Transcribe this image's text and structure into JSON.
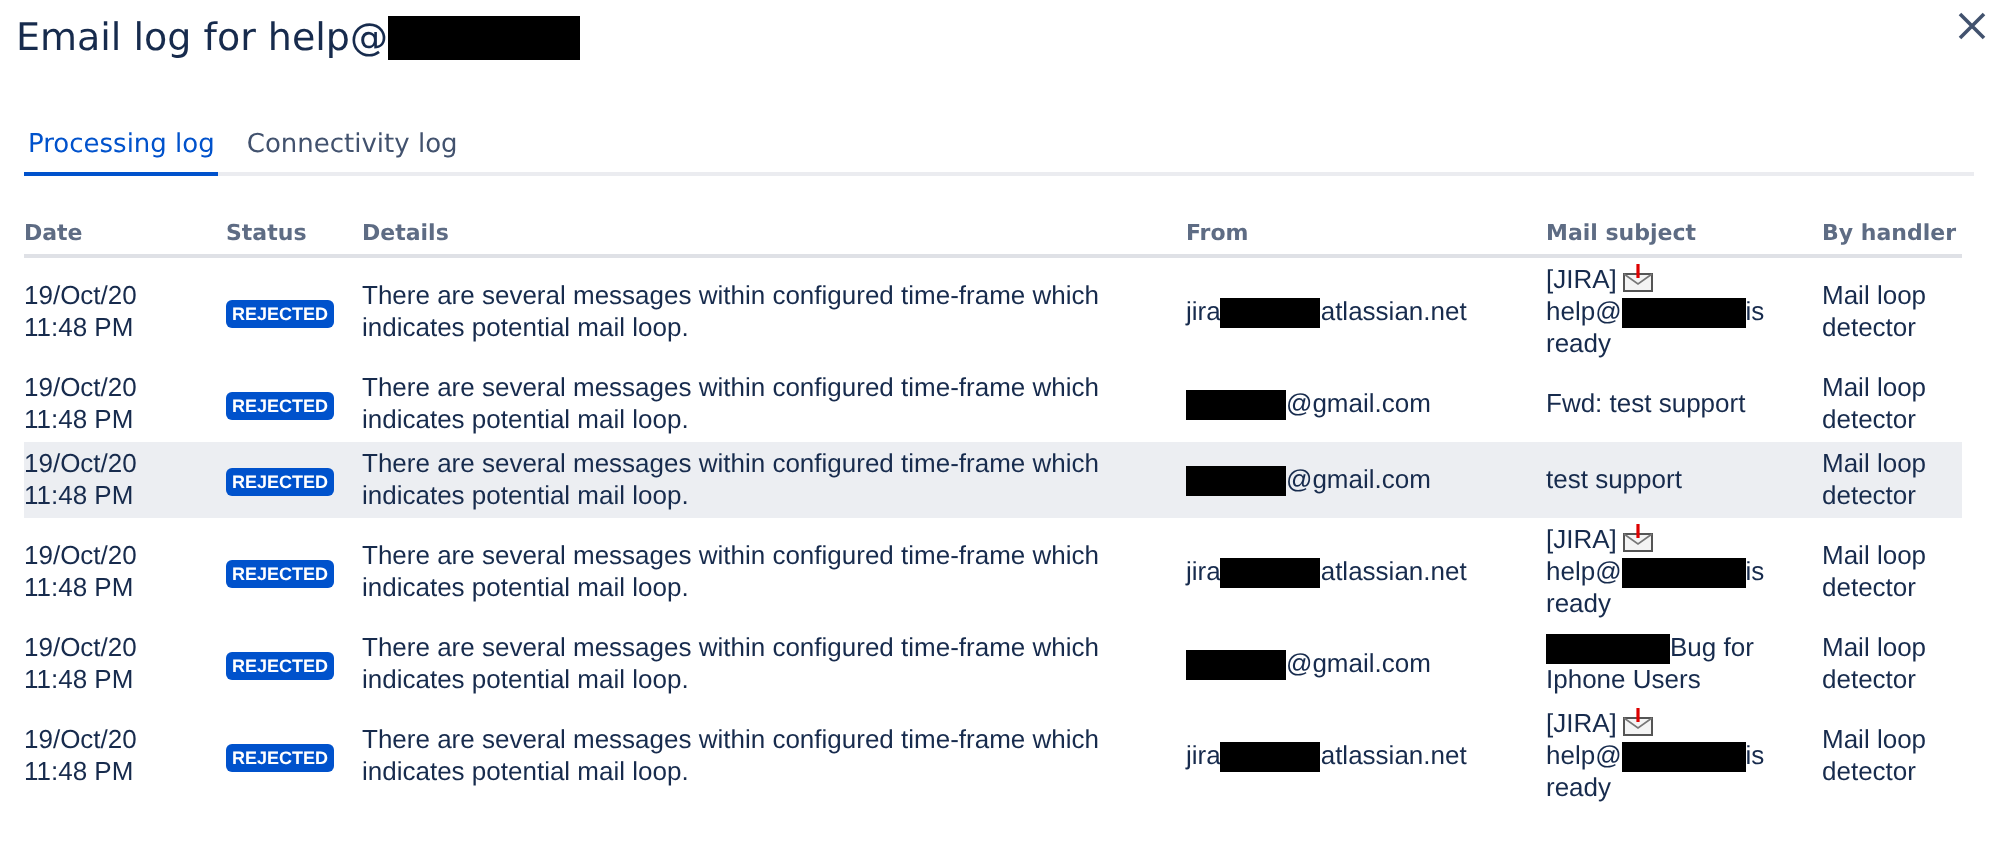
{
  "title": [
    {
      "kind": "text",
      "text": "Email log for help@"
    },
    {
      "kind": "redaction"
    }
  ],
  "tabs": [
    {
      "label": "Processing log",
      "selected": true
    },
    {
      "label": "Connectivity log",
      "selected": false
    }
  ],
  "table": {
    "columns": [
      "Date",
      "Status",
      "Details",
      "From",
      "Mail subject",
      "By handler"
    ],
    "rows": [
      {
        "highlighted": false,
        "date": "19/Oct/20 11:48 PM",
        "status": "REJECTED",
        "details": "There are several messages within configured time-frame which indicates potential mail loop.",
        "from": [
          {
            "kind": "text",
            "text": "jira"
          },
          {
            "kind": "redaction"
          },
          {
            "kind": "text",
            "text": "atlassian.net"
          }
        ],
        "subject": [
          [
            {
              "kind": "text",
              "text": "[JIRA]"
            },
            {
              "kind": "envelope"
            }
          ],
          [
            {
              "kind": "text",
              "text": "help@"
            },
            {
              "kind": "redaction"
            },
            {
              "kind": "text",
              "text": "is"
            }
          ],
          [
            {
              "kind": "text",
              "text": "ready"
            }
          ]
        ],
        "handler": "Mail loop detector"
      },
      {
        "highlighted": false,
        "date": "19/Oct/20 11:48 PM",
        "status": "REJECTED",
        "details": "There are several messages within configured time-frame which indicates potential mail loop.",
        "from": [
          {
            "kind": "redaction"
          },
          {
            "kind": "text",
            "text": "@gmail.com"
          }
        ],
        "subject": [
          [
            {
              "kind": "text",
              "text": "Fwd: test support"
            }
          ]
        ],
        "handler": "Mail loop detector"
      },
      {
        "highlighted": true,
        "date": "19/Oct/20 11:48 PM",
        "status": "REJECTED",
        "details": "There are several messages within configured time-frame which indicates potential mail loop.",
        "from": [
          {
            "kind": "redaction"
          },
          {
            "kind": "text",
            "text": "@gmail.com"
          }
        ],
        "subject": [
          [
            {
              "kind": "text",
              "text": "test support"
            }
          ]
        ],
        "handler": "Mail loop detector"
      },
      {
        "highlighted": false,
        "date": "19/Oct/20 11:48 PM",
        "status": "REJECTED",
        "details": "There are several messages within configured time-frame which indicates potential mail loop.",
        "from": [
          {
            "kind": "text",
            "text": "jira"
          },
          {
            "kind": "redaction"
          },
          {
            "kind": "text",
            "text": "atlassian.net"
          }
        ],
        "subject": [
          [
            {
              "kind": "text",
              "text": "[JIRA]"
            },
            {
              "kind": "envelope"
            }
          ],
          [
            {
              "kind": "text",
              "text": "help@"
            },
            {
              "kind": "redaction"
            },
            {
              "kind": "text",
              "text": "is"
            }
          ],
          [
            {
              "kind": "text",
              "text": "ready"
            }
          ]
        ],
        "handler": "Mail loop detector"
      },
      {
        "highlighted": false,
        "date": "19/Oct/20 11:48 PM",
        "status": "REJECTED",
        "details": "There are several messages within configured time-frame which indicates potential mail loop.",
        "from": [
          {
            "kind": "redaction"
          },
          {
            "kind": "text",
            "text": "@gmail.com"
          }
        ],
        "subject": [
          [
            {
              "kind": "redaction"
            },
            {
              "kind": "text",
              "text": "Bug for"
            }
          ],
          [
            {
              "kind": "text",
              "text": "Iphone Users"
            }
          ]
        ],
        "handler": "Mail loop detector"
      },
      {
        "highlighted": false,
        "date": "19/Oct/20 11:48 PM",
        "status": "REJECTED",
        "details": "There are several messages within configured time-frame which indicates potential mail loop.",
        "from": [
          {
            "kind": "text",
            "text": "jira"
          },
          {
            "kind": "redaction"
          },
          {
            "kind": "text",
            "text": "atlassian.net"
          }
        ],
        "subject": [
          [
            {
              "kind": "text",
              "text": "[JIRA]"
            },
            {
              "kind": "envelope"
            }
          ],
          [
            {
              "kind": "text",
              "text": "help@"
            },
            {
              "kind": "redaction"
            },
            {
              "kind": "text",
              "text": "is"
            }
          ],
          [
            {
              "kind": "text",
              "text": "ready"
            }
          ]
        ],
        "handler": "Mail loop detector"
      }
    ]
  }
}
